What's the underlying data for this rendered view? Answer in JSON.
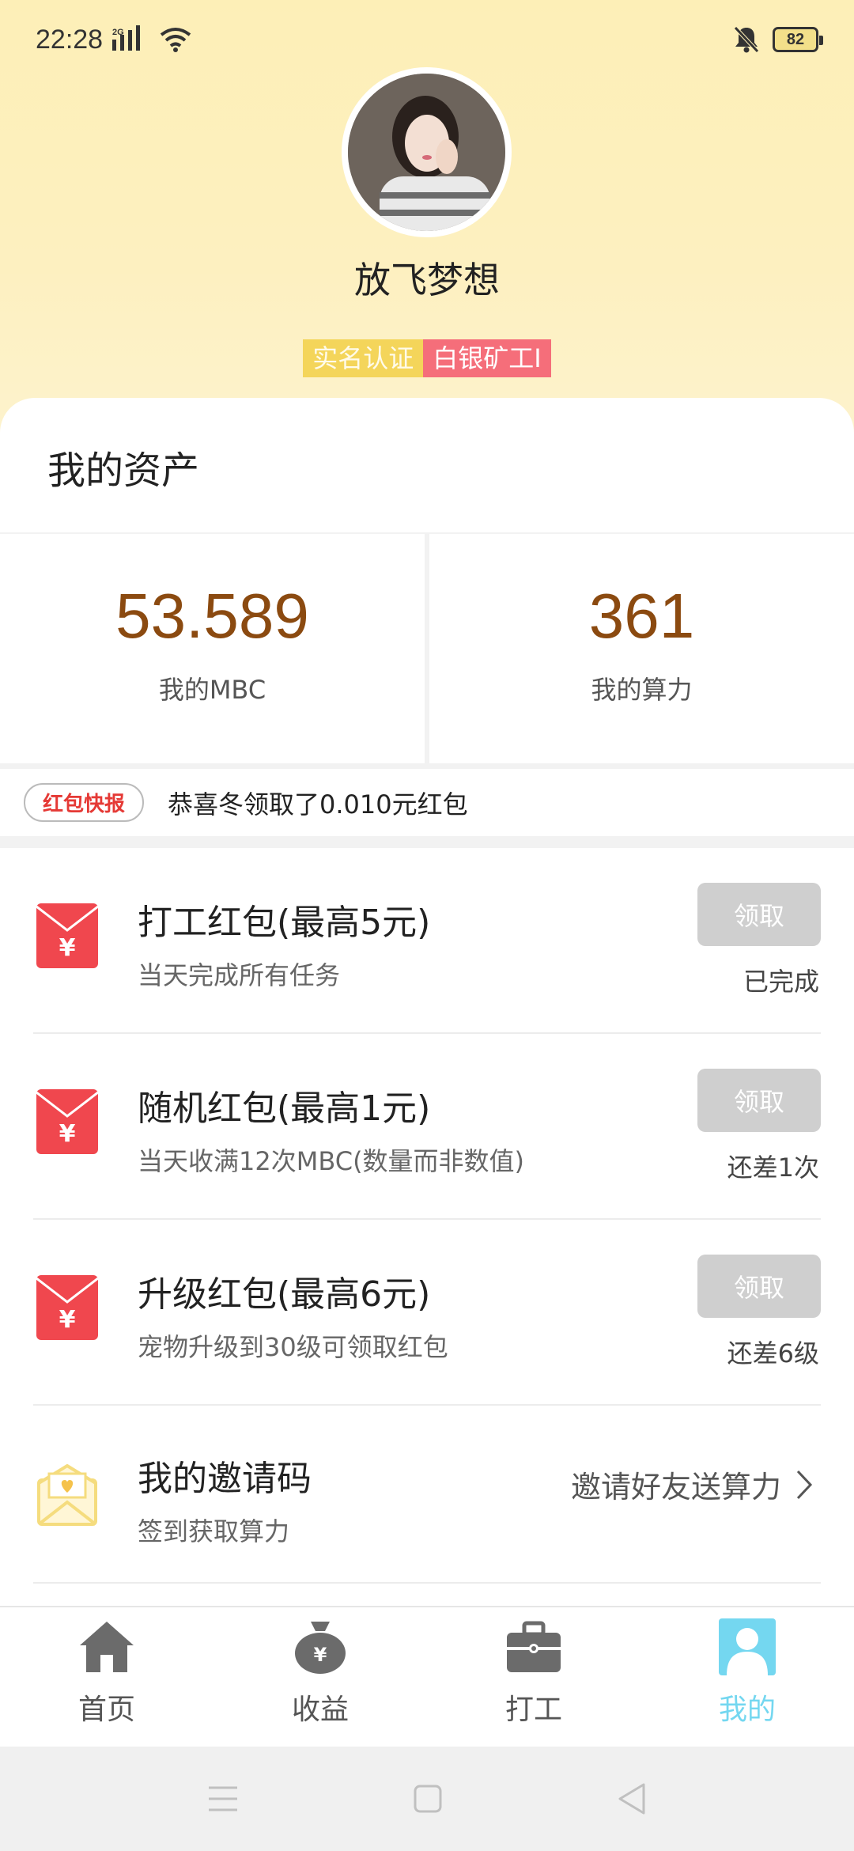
{
  "status_bar": {
    "time": "22:28",
    "network": "2G",
    "battery": "82"
  },
  "profile": {
    "username": "放飞梦想",
    "badges": [
      "实名认证",
      "白银矿工I"
    ]
  },
  "assets": {
    "title": "我的资产",
    "mbc_value": "53.589",
    "mbc_label": "我的MBC",
    "power_value": "361",
    "power_label": "我的算力"
  },
  "ticker": {
    "tag": "红包快报",
    "text": "恭喜冬领取了0.010元红包"
  },
  "tasks": [
    {
      "title": "打工红包(最高5元)",
      "subtitle": "当天完成所有任务",
      "button": "领取",
      "status": "已完成"
    },
    {
      "title": "随机红包(最高1元)",
      "subtitle": "当天收满12次MBC(数量而非数值)",
      "button": "领取",
      "status": "还差1次"
    },
    {
      "title": "升级红包(最高6元)",
      "subtitle": "宠物升级到30级可领取红包",
      "button": "领取",
      "status": "还差6级"
    }
  ],
  "invite": {
    "title": "我的邀请码",
    "subtitle": "签到获取算力",
    "link": "邀请好友送算力"
  },
  "nav": {
    "items": [
      {
        "label": "首页",
        "icon": "home-icon"
      },
      {
        "label": "收益",
        "icon": "money-bag-icon"
      },
      {
        "label": "打工",
        "icon": "briefcase-icon"
      },
      {
        "label": "我的",
        "icon": "profile-icon"
      }
    ],
    "active": "我的"
  },
  "colors": {
    "accent_brown": "#8b4a10",
    "red_envelope": "#f0474e",
    "active_nav": "#74d7f0",
    "badge_yellow": "#f4d55a",
    "badge_pink": "#f56e7a"
  }
}
